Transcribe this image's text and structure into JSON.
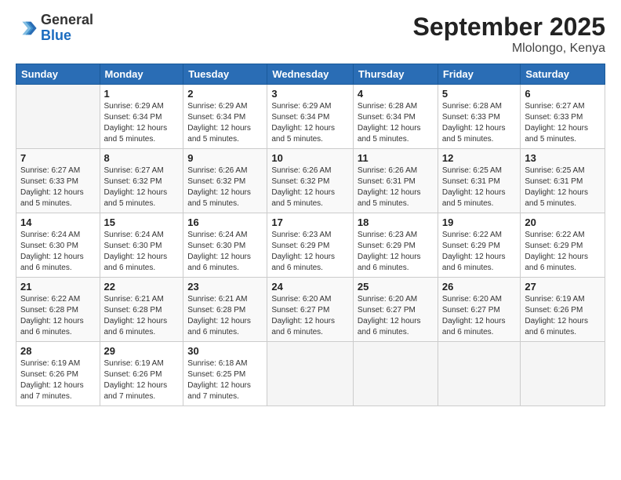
{
  "logo": {
    "general": "General",
    "blue": "Blue"
  },
  "header": {
    "month": "September 2025",
    "location": "Mlolongo, Kenya"
  },
  "days_of_week": [
    "Sunday",
    "Monday",
    "Tuesday",
    "Wednesday",
    "Thursday",
    "Friday",
    "Saturday"
  ],
  "weeks": [
    [
      {
        "day": "",
        "info": ""
      },
      {
        "day": "1",
        "info": "Sunrise: 6:29 AM\nSunset: 6:34 PM\nDaylight: 12 hours\nand 5 minutes."
      },
      {
        "day": "2",
        "info": "Sunrise: 6:29 AM\nSunset: 6:34 PM\nDaylight: 12 hours\nand 5 minutes."
      },
      {
        "day": "3",
        "info": "Sunrise: 6:29 AM\nSunset: 6:34 PM\nDaylight: 12 hours\nand 5 minutes."
      },
      {
        "day": "4",
        "info": "Sunrise: 6:28 AM\nSunset: 6:34 PM\nDaylight: 12 hours\nand 5 minutes."
      },
      {
        "day": "5",
        "info": "Sunrise: 6:28 AM\nSunset: 6:33 PM\nDaylight: 12 hours\nand 5 minutes."
      },
      {
        "day": "6",
        "info": "Sunrise: 6:27 AM\nSunset: 6:33 PM\nDaylight: 12 hours\nand 5 minutes."
      }
    ],
    [
      {
        "day": "7",
        "info": "Sunrise: 6:27 AM\nSunset: 6:33 PM\nDaylight: 12 hours\nand 5 minutes."
      },
      {
        "day": "8",
        "info": "Sunrise: 6:27 AM\nSunset: 6:32 PM\nDaylight: 12 hours\nand 5 minutes."
      },
      {
        "day": "9",
        "info": "Sunrise: 6:26 AM\nSunset: 6:32 PM\nDaylight: 12 hours\nand 5 minutes."
      },
      {
        "day": "10",
        "info": "Sunrise: 6:26 AM\nSunset: 6:32 PM\nDaylight: 12 hours\nand 5 minutes."
      },
      {
        "day": "11",
        "info": "Sunrise: 6:26 AM\nSunset: 6:31 PM\nDaylight: 12 hours\nand 5 minutes."
      },
      {
        "day": "12",
        "info": "Sunrise: 6:25 AM\nSunset: 6:31 PM\nDaylight: 12 hours\nand 5 minutes."
      },
      {
        "day": "13",
        "info": "Sunrise: 6:25 AM\nSunset: 6:31 PM\nDaylight: 12 hours\nand 5 minutes."
      }
    ],
    [
      {
        "day": "14",
        "info": "Sunrise: 6:24 AM\nSunset: 6:30 PM\nDaylight: 12 hours\nand 6 minutes."
      },
      {
        "day": "15",
        "info": "Sunrise: 6:24 AM\nSunset: 6:30 PM\nDaylight: 12 hours\nand 6 minutes."
      },
      {
        "day": "16",
        "info": "Sunrise: 6:24 AM\nSunset: 6:30 PM\nDaylight: 12 hours\nand 6 minutes."
      },
      {
        "day": "17",
        "info": "Sunrise: 6:23 AM\nSunset: 6:29 PM\nDaylight: 12 hours\nand 6 minutes."
      },
      {
        "day": "18",
        "info": "Sunrise: 6:23 AM\nSunset: 6:29 PM\nDaylight: 12 hours\nand 6 minutes."
      },
      {
        "day": "19",
        "info": "Sunrise: 6:22 AM\nSunset: 6:29 PM\nDaylight: 12 hours\nand 6 minutes."
      },
      {
        "day": "20",
        "info": "Sunrise: 6:22 AM\nSunset: 6:29 PM\nDaylight: 12 hours\nand 6 minutes."
      }
    ],
    [
      {
        "day": "21",
        "info": "Sunrise: 6:22 AM\nSunset: 6:28 PM\nDaylight: 12 hours\nand 6 minutes."
      },
      {
        "day": "22",
        "info": "Sunrise: 6:21 AM\nSunset: 6:28 PM\nDaylight: 12 hours\nand 6 minutes."
      },
      {
        "day": "23",
        "info": "Sunrise: 6:21 AM\nSunset: 6:28 PM\nDaylight: 12 hours\nand 6 minutes."
      },
      {
        "day": "24",
        "info": "Sunrise: 6:20 AM\nSunset: 6:27 PM\nDaylight: 12 hours\nand 6 minutes."
      },
      {
        "day": "25",
        "info": "Sunrise: 6:20 AM\nSunset: 6:27 PM\nDaylight: 12 hours\nand 6 minutes."
      },
      {
        "day": "26",
        "info": "Sunrise: 6:20 AM\nSunset: 6:27 PM\nDaylight: 12 hours\nand 6 minutes."
      },
      {
        "day": "27",
        "info": "Sunrise: 6:19 AM\nSunset: 6:26 PM\nDaylight: 12 hours\nand 6 minutes."
      }
    ],
    [
      {
        "day": "28",
        "info": "Sunrise: 6:19 AM\nSunset: 6:26 PM\nDaylight: 12 hours\nand 7 minutes."
      },
      {
        "day": "29",
        "info": "Sunrise: 6:19 AM\nSunset: 6:26 PM\nDaylight: 12 hours\nand 7 minutes."
      },
      {
        "day": "30",
        "info": "Sunrise: 6:18 AM\nSunset: 6:25 PM\nDaylight: 12 hours\nand 7 minutes."
      },
      {
        "day": "",
        "info": ""
      },
      {
        "day": "",
        "info": ""
      },
      {
        "day": "",
        "info": ""
      },
      {
        "day": "",
        "info": ""
      }
    ]
  ]
}
